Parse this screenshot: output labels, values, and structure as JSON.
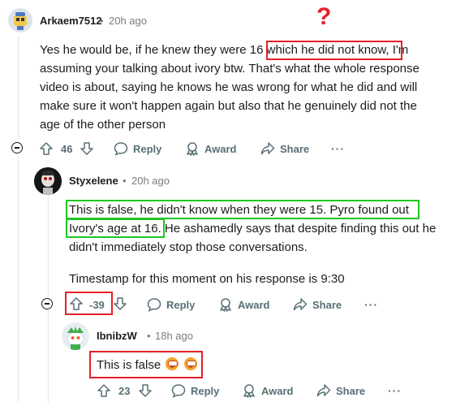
{
  "comments": [
    {
      "username": "Arkaem7512",
      "time": "20h ago",
      "lines": [
        "Yes he would be, if he knew they were 16 which he did not know, I'm",
        "assuming your talking about ivory btw. That's what the whole response",
        "video is about, saying he knows he was wrong for what he did and will",
        "make sure it won't happen again but also that he genuinely did not the",
        "age of the other person"
      ],
      "score": "46"
    },
    {
      "username": "Styxelene",
      "time": "20h ago",
      "lines": [
        "This is false, he didn't know when they were 15. Pyro found out",
        "Ivory's age at 16. He ashamedly says that despite finding this out he",
        "didn't immediately stop those conversations.",
        "",
        "Timestamp for this moment on his response is 9:30"
      ],
      "score": "-39"
    },
    {
      "username": "IbnibzW",
      "time": "18h ago",
      "lines": [
        "This is false"
      ],
      "score": "23"
    }
  ],
  "labels": {
    "reply": "Reply",
    "award": "Award",
    "share": "Share",
    "more": "···",
    "dot": "•",
    "annotation_mark": "?"
  },
  "annotation_colors": {
    "red": "#e5202a",
    "green": "#21c522"
  },
  "icons": [
    "upvote-icon",
    "downvote-icon",
    "reply-icon",
    "award-icon",
    "share-icon",
    "collapse-icon",
    "more-icon"
  ]
}
